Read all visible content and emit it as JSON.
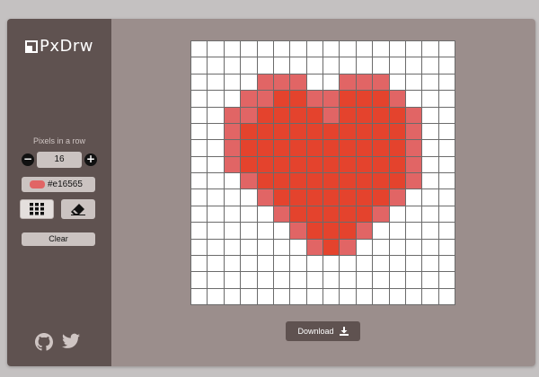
{
  "app": {
    "logo_text": "PxDrw"
  },
  "sidebar": {
    "pixels_label": "Pixels in a row",
    "pixels_value": "16",
    "color_hex": "#e16565",
    "clear_label": "Clear",
    "active_tool": "pencil-grid"
  },
  "canvas": {
    "size": 16,
    "empty_color": "#ffffff",
    "grid_line_color": "#6b6b6b",
    "palette": {
      "1": "#e16565",
      "2": "#e4432d"
    },
    "rows": [
      "0000000000000000",
      "0000000000000000",
      "0000111001110000",
      "0001122112221000",
      "0011222212222100",
      "0012222222222100",
      "0012222222222100",
      "0012222222222100",
      "0001222222222100",
      "0000122222221000",
      "0000012222210000",
      "0000001222100000",
      "0000000121000000",
      "0000000000000000",
      "0000000000000000",
      "0000000000000000"
    ]
  },
  "main": {
    "download_label": "Download"
  },
  "icons": {
    "github": "github-icon",
    "twitter": "twitter-icon",
    "download": "download-icon",
    "grid": "grid-icon",
    "eraser": "eraser-icon",
    "minus": "minus-icon",
    "plus": "plus-icon"
  }
}
